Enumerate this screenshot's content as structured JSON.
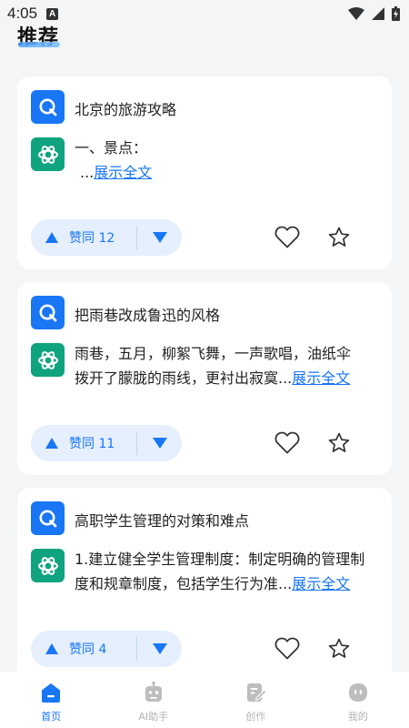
{
  "status": {
    "time": "4:05",
    "notif_letter": "A"
  },
  "page": {
    "title": "推荐"
  },
  "cards": [
    {
      "question": "北京的旅游攻略",
      "answer_lines": [
        "一、景点：",
        "..."
      ],
      "expand": "展示全文",
      "vote_label": "赞同 12"
    },
    {
      "question": "把雨巷改成鲁迅的风格",
      "answer_lines": [
        "雨巷，五月，柳絮飞舞，一声歌唱，油纸伞",
        "拨开了朦胧的雨线，更衬出寂寞..."
      ],
      "expand": "展示全文",
      "vote_label": "赞同 11"
    },
    {
      "question": "高职学生管理的对策和难点",
      "answer_lines": [
        "1.建立健全学生管理制度：制定明确的管理制",
        "度和规章制度，包括学生行为准..."
      ],
      "expand": "展示全文",
      "vote_label": "赞同 4"
    }
  ],
  "tabs": [
    {
      "label": "首页",
      "icon": "home-icon"
    },
    {
      "label": "AI助手",
      "icon": "robot-icon"
    },
    {
      "label": "创作",
      "icon": "edit-icon"
    },
    {
      "label": "我的",
      "icon": "profile-icon"
    }
  ],
  "colors": {
    "accent": "#1976f5",
    "gpt_green": "#0fa37f",
    "vote_bg": "#e5effd"
  }
}
